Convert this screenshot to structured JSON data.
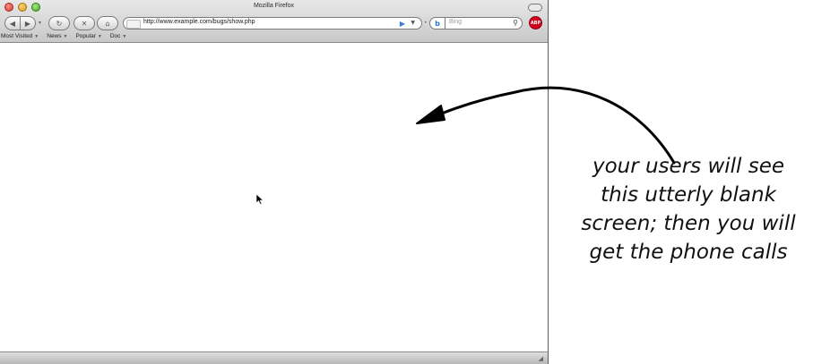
{
  "window": {
    "title": "Mozilla Firefox"
  },
  "toolbar": {
    "url": "http://www.example.com/bugs/show.php",
    "search_placeholder": "Bing",
    "adblock_label": "ABP"
  },
  "bookmarks": [
    {
      "label": "Most Visited",
      "has_menu": true
    },
    {
      "label": "News",
      "has_menu": true
    },
    {
      "label": "Popular",
      "has_menu": true
    },
    {
      "label": "Doc",
      "has_menu": true
    }
  ],
  "annotation": {
    "lines": [
      "your users will see",
      "this utterly blank",
      "screen; then you will",
      "get the phone calls"
    ]
  },
  "icons": {
    "back": "back-arrow-icon",
    "forward": "forward-arrow-icon",
    "reload": "reload-icon",
    "stop": "stop-icon",
    "home": "home-icon",
    "go": "go-arrow-icon",
    "search": "magnifier-icon",
    "engine": "bing-logo-icon"
  }
}
